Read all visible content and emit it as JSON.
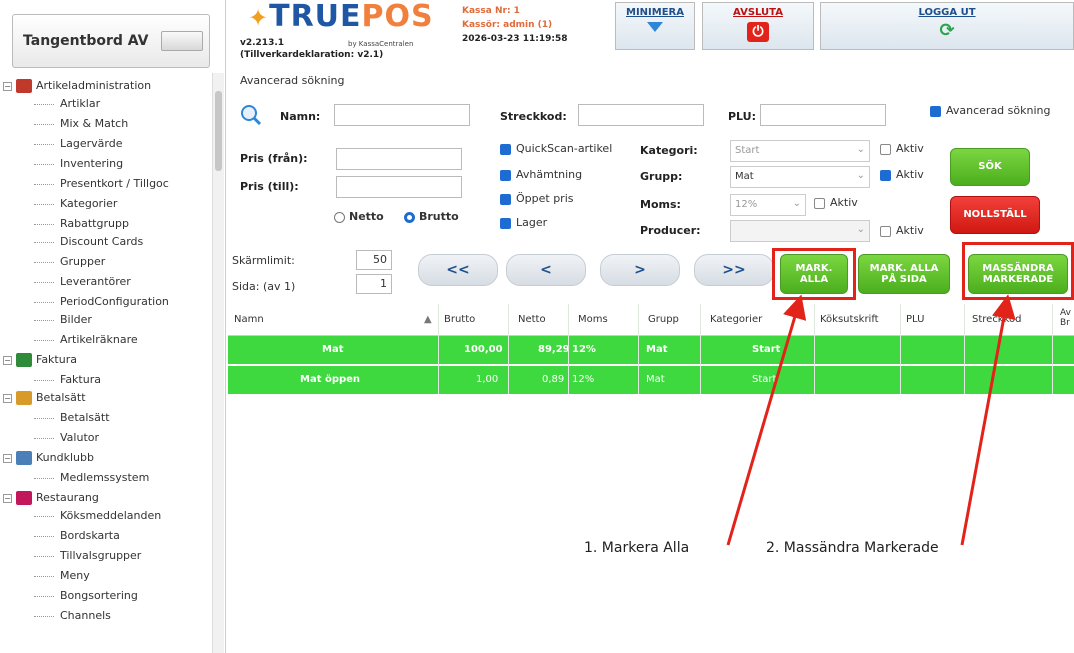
{
  "sidebar": {
    "title": "Tangentbord AV",
    "groups": [
      {
        "label": "Artikeladministration",
        "items": [
          "Artiklar",
          "Mix & Match",
          "Lagervärde",
          "Inventering",
          "Presentkort / Tillgoc",
          "Kategorier",
          "Rabattgrupp",
          "Discount Cards",
          "Grupper",
          "Leverantörer",
          "PeriodConfiguration",
          "Bilder",
          "Artikelräknare"
        ]
      },
      {
        "label": "Faktura",
        "items": [
          "Faktura"
        ]
      },
      {
        "label": "Betalsätt",
        "items": [
          "Betalsätt",
          "Valutor"
        ]
      },
      {
        "label": "Kundklubb",
        "items": [
          "Medlemssystem"
        ]
      },
      {
        "label": "Restaurang",
        "items": [
          "Köksmeddelanden",
          "Bordskarta",
          "Tillvalsgrupper",
          "Meny",
          "Bongsortering",
          "Channels"
        ]
      }
    ]
  },
  "header": {
    "logo_tru": "TRUE",
    "logo_pos": "POS",
    "version": "v2.213.1",
    "version_sub": "by KassaCentralen",
    "tillverkardeklaration": "(Tillverkardeklaration: v2.1)",
    "avancerad_sokning": "Avancerad sökning",
    "kassa_label": "Kassa Nr: 1",
    "kassor_label": "Kassör: admin (1)",
    "datetime": "2026-03-23 11:19:58",
    "minimera": "MINIMERA",
    "avsluta": "AVSLUTA",
    "logga_ut": "LOGGA UT"
  },
  "form": {
    "namn_label": "Namn:",
    "streckkod_label": "Streckkod:",
    "plu_label": "PLU:",
    "avancerad_checkbox": "Avancerad sökning",
    "pris_fran_label": "Pris (från):",
    "pris_till_label": "Pris (till):",
    "netto": "Netto",
    "brutto": "Brutto",
    "quickscan": "QuickScan-artikel",
    "avhamtning": "Avhämtning",
    "oppet_pris": "Öppet pris",
    "lager": "Lager",
    "kategori_label": "Kategori:",
    "grupp_label": "Grupp:",
    "moms_label": "Moms:",
    "producer_label": "Producer:",
    "kategori_value": "Start",
    "grupp_value": "Mat",
    "moms_value": "12%",
    "producer_value": "",
    "aktiv": "Aktiv",
    "sok": "SÖK",
    "nollstall": "NOLLSTÄLL"
  },
  "pager": {
    "skarmlimit_label": "Skärmlimit:",
    "skarmlimit_value": "50",
    "sida_label": "Sida: (av 1)",
    "sida_value": "1",
    "first": "<<",
    "prev": "<",
    "next": ">",
    "last": ">>",
    "mark_alla_1": "MARK.",
    "mark_alla_2": "ALLA",
    "mark_alla_sida_1": "MARK. ALLA",
    "mark_alla_sida_2": "PÅ SIDA",
    "massandra_1": "MASSÄNDRA",
    "massandra_2": "MARKERADE"
  },
  "table": {
    "columns": [
      "Namn",
      "Brutto",
      "Netto",
      "Moms",
      "Grupp",
      "Kategorier",
      "Köksutskrift",
      "PLU",
      "Streckkod",
      "Av Br"
    ],
    "rows": [
      {
        "namn": "Mat",
        "brutto": "100,00",
        "netto": "89,29",
        "moms": "12%",
        "grupp": "Mat",
        "kategorier": "Start"
      },
      {
        "namn": "Mat öppen",
        "brutto": "1,00",
        "netto": "0,89",
        "moms": "12%",
        "grupp": "Mat",
        "kategorier": "Start"
      }
    ]
  },
  "annotations": {
    "a1": "1. Markera Alla",
    "a2": "2. Massändra Markerade"
  },
  "colors": {
    "green": "#3ed93e",
    "red": "#e2231a",
    "blue": "#1e6cd1"
  }
}
